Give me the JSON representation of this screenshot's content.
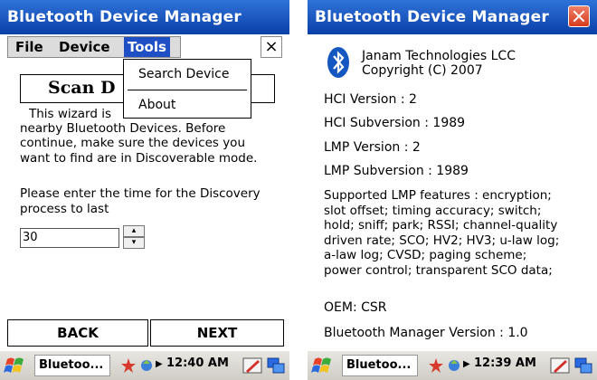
{
  "left": {
    "title": "Bluetooth Device Manager",
    "menu": {
      "file": "File",
      "device": "Device",
      "tools": "Tools",
      "close": "×"
    },
    "dropdown": {
      "search": "Search Device",
      "about": "About"
    },
    "scan_label": "Scan D",
    "intro_lines": [
      "This wizard is",
      "nearby Bluetooth Devices. Before",
      "continue, make sure the devices you",
      "want to find are in Discoverable mode."
    ],
    "prompt_lines": [
      "Please enter the time for the Discovery",
      "process to last"
    ],
    "time_value": "30",
    "back": "BACK",
    "next": "NEXT",
    "taskbar": {
      "app": "Bluetoo...",
      "time": "12:40 AM"
    }
  },
  "right": {
    "title": "Bluetooth Device Manager",
    "company": "Janam Technologies LCC",
    "copyright": "Copyright (C) 2007",
    "hci_version": "HCI Version : 2",
    "hci_subversion": "HCI Subversion : 1989",
    "lmp_version": "LMP Version : 2",
    "lmp_subversion": "LMP Subversion : 1989",
    "features_lines": [
      "Supported LMP features : encryption;",
      "slot offset; timing accuracy; switch;",
      "hold; sniff; park; RSSI; channel-quality",
      "driven rate; SCO; HV2; HV3; u-law log;",
      "a-law log; CVSD; paging scheme;",
      "power control; transparent SCO data;"
    ],
    "oem": "OEM: CSR",
    "manager_version": "Bluetooth Manager Version : 1.0",
    "taskbar": {
      "app": "Bluetoo...",
      "time": "12:39 AM"
    }
  },
  "colors": {
    "titlebar": "#1f5bc8",
    "menu_highlight": "#1e4fc4",
    "close_red": "#d9472b",
    "taskbar": "#d9d7d0"
  }
}
